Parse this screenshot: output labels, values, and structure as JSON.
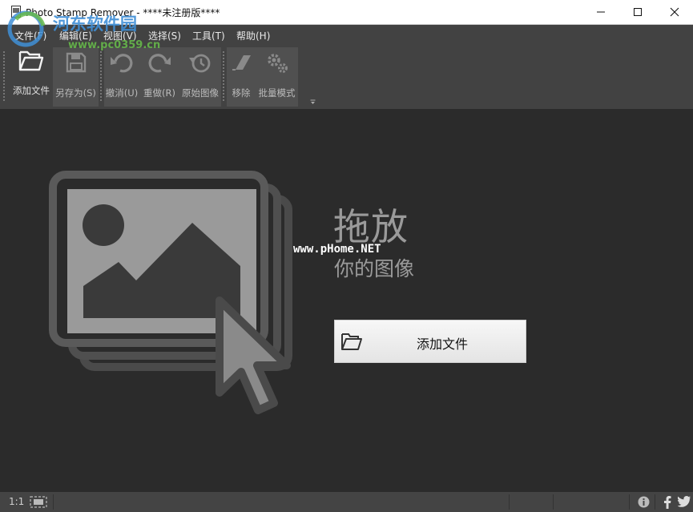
{
  "window": {
    "title": "Photo Stamp Remover - ****未注册版****",
    "minimize_icon": "minimize-icon",
    "maximize_icon": "maximize-icon",
    "close_icon": "close-icon"
  },
  "menu": {
    "items": [
      {
        "label": "文件(F)"
      },
      {
        "label": "编辑(E)"
      },
      {
        "label": "视图(V)"
      },
      {
        "label": "选择(S)"
      },
      {
        "label": "工具(T)"
      },
      {
        "label": "帮助(H)"
      }
    ]
  },
  "toolbar": {
    "add_file": {
      "label": "添加文件",
      "icon": "folder-open-icon"
    },
    "save_as": {
      "label": "另存为(S)",
      "icon": "floppy-disk-icon"
    },
    "undo": {
      "label": "撤消(U)",
      "icon": "undo-icon"
    },
    "redo": {
      "label": "重做(R)",
      "icon": "redo-icon"
    },
    "original": {
      "label": "原始图像",
      "icon": "history-icon"
    },
    "remove": {
      "label": "移除",
      "icon": "eraser-icon"
    },
    "batch": {
      "label": "批量模式",
      "icon": "gears-icon"
    },
    "overflow_icon": "chevron-down-icon"
  },
  "main": {
    "drop_line1": "拖放",
    "drop_line2": "你的图像",
    "add_button_label": "添加文件",
    "placeholder_icon": "image-stack-cursor-icon"
  },
  "statusbar": {
    "zoom": "1:1",
    "fit_icon": "fit-screen-icon",
    "info_icon": "info-icon",
    "facebook_icon": "facebook-icon",
    "twitter_icon": "twitter-icon"
  },
  "watermarks": {
    "site_name": "河东软件园",
    "site_url": "www.pc0359.cn",
    "overlay": "www.pHome.NET"
  },
  "colors": {
    "background": "#2b2b2b",
    "toolbar": "#424242",
    "toolbar_group": "#505050",
    "icon_gray": "#8a8a8a",
    "placeholder_gray": "#9a9a9a"
  }
}
